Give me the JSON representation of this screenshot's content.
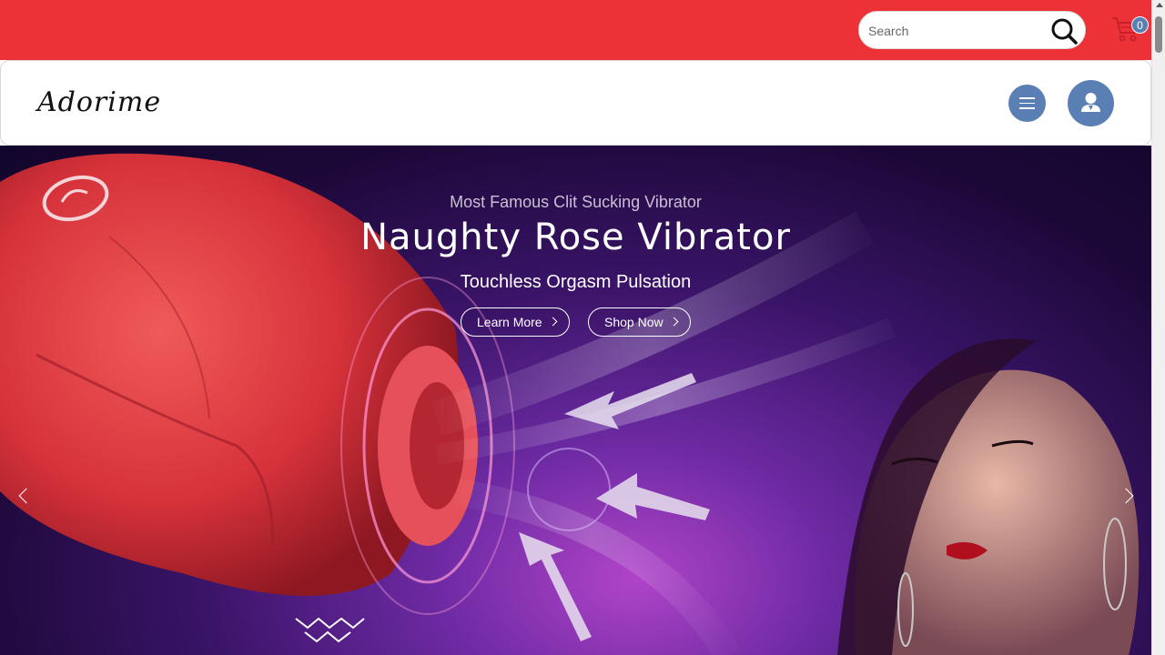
{
  "topbar": {
    "search_placeholder": "Search",
    "cart_count": "0",
    "colors": {
      "bar": "#ec3237",
      "badge": "#5a7fb5"
    }
  },
  "header": {
    "logo_text": "Adorime"
  },
  "hero": {
    "pretitle": "Most Famous Clit Sucking Vibrator",
    "title": "Naughty Rose Vibrator",
    "subtitle": "Touchless Orgasm Pulsation",
    "learn_more_label": "Learn More",
    "shop_now_label": "Shop Now"
  },
  "icons": {
    "search": "search-icon",
    "cart": "cart-icon",
    "menu": "menu-icon",
    "user": "user-icon",
    "prev": "chevron-left-icon",
    "next": "chevron-right-icon"
  }
}
